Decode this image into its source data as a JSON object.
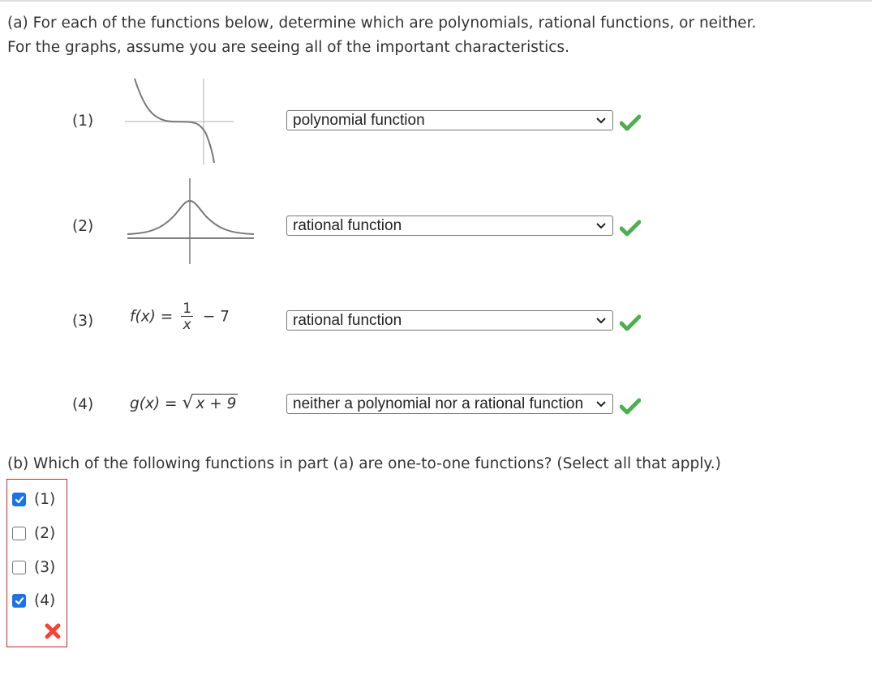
{
  "part_a": {
    "prompt_line1": "(a) For each of the functions below, determine which are polynomials, rational functions, or neither.",
    "prompt_line2": "For the graphs, assume you are seeing all of the important characteristics.",
    "items": [
      {
        "label": "(1)",
        "type": "graph",
        "graph": "cubic-decreasing",
        "selected": "polynomial function",
        "status": "correct"
      },
      {
        "label": "(2)",
        "type": "graph",
        "graph": "bell-curve-asymptote",
        "selected": "rational function",
        "status": "correct"
      },
      {
        "label": "(3)",
        "type": "formula",
        "formula": {
          "name": "f(x)",
          "equals": "=",
          "numerator": "1",
          "denominator": "x",
          "tail": "− 7"
        },
        "selected": "rational function",
        "status": "correct"
      },
      {
        "label": "(4)",
        "type": "formula",
        "formula": {
          "name": "g(x)",
          "equals": "=",
          "radical": "√",
          "radicand": "x + 9"
        },
        "selected": "neither a polynomial nor a rational function",
        "status": "correct"
      }
    ]
  },
  "part_b": {
    "prompt": "(b) Which of the following functions in part (a) are one-to-one functions? (Select all that apply.)",
    "options": [
      {
        "label": "(1)",
        "checked": true
      },
      {
        "label": "(2)",
        "checked": false
      },
      {
        "label": "(3)",
        "checked": false
      },
      {
        "label": "(4)",
        "checked": true
      }
    ],
    "status": "incorrect"
  },
  "colors": {
    "correct": "#4caf50",
    "incorrect": "#f44336",
    "checkbox_checked": "#1a73e8",
    "answer_box_border": "#c62828"
  }
}
